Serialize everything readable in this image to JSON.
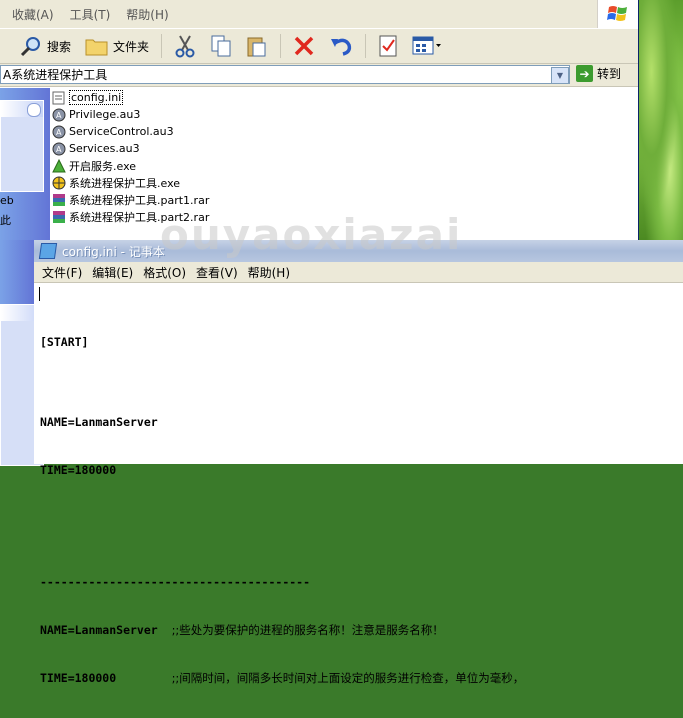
{
  "explorer": {
    "menu": [
      "收藏(A)",
      "工具(T)",
      "帮助(H)"
    ],
    "toolbar": {
      "search_label": "搜索",
      "folders_label": "文件夹"
    },
    "address": "A系统进程保护工具",
    "goto_label": "转到",
    "left_text": [
      "eb",
      "此"
    ],
    "files": [
      {
        "name": "config.ini",
        "icon": "ini-file-icon",
        "selected": true
      },
      {
        "name": "Privilege.au3",
        "icon": "autoit-script-icon"
      },
      {
        "name": "ServiceControl.au3",
        "icon": "autoit-script-icon"
      },
      {
        "name": "Services.au3",
        "icon": "autoit-script-icon"
      },
      {
        "name": "开启服务.exe",
        "icon": "exe-triangle-icon"
      },
      {
        "name": "系统进程保护工具.exe",
        "icon": "exe-shield-icon"
      },
      {
        "name": "系统进程保护工具.part1.rar",
        "icon": "rar-archive-icon"
      },
      {
        "name": "系统进程保护工具.part2.rar",
        "icon": "rar-archive-icon"
      }
    ]
  },
  "watermark": "ouyaoxiazai",
  "notepad": {
    "title": "config.ini - 记事本",
    "menu": [
      "文件(F)",
      "编辑(E)",
      "格式(O)",
      "查看(V)",
      "帮助(H)"
    ],
    "lines": [
      {
        "code": "[START]",
        "comment": ""
      },
      {
        "code": "",
        "comment": ""
      },
      {
        "code": "NAME=LanmanServer",
        "comment": ""
      },
      {
        "code": "TIME=180000",
        "comment": ""
      },
      {
        "code": "",
        "comment": ""
      },
      {
        "code": "",
        "comment": ""
      },
      {
        "code": "---------------------------------------",
        "comment": ""
      },
      {
        "code": "NAME=LanmanServer  ",
        "comment": ";;些处为要保护的进程的服务名称！注意是服务名称！"
      },
      {
        "code": "TIME=180000        ",
        "comment": ";;间隔时间，间隔多长时间对上面设定的服务进行检查，单位为毫秒，"
      }
    ]
  }
}
